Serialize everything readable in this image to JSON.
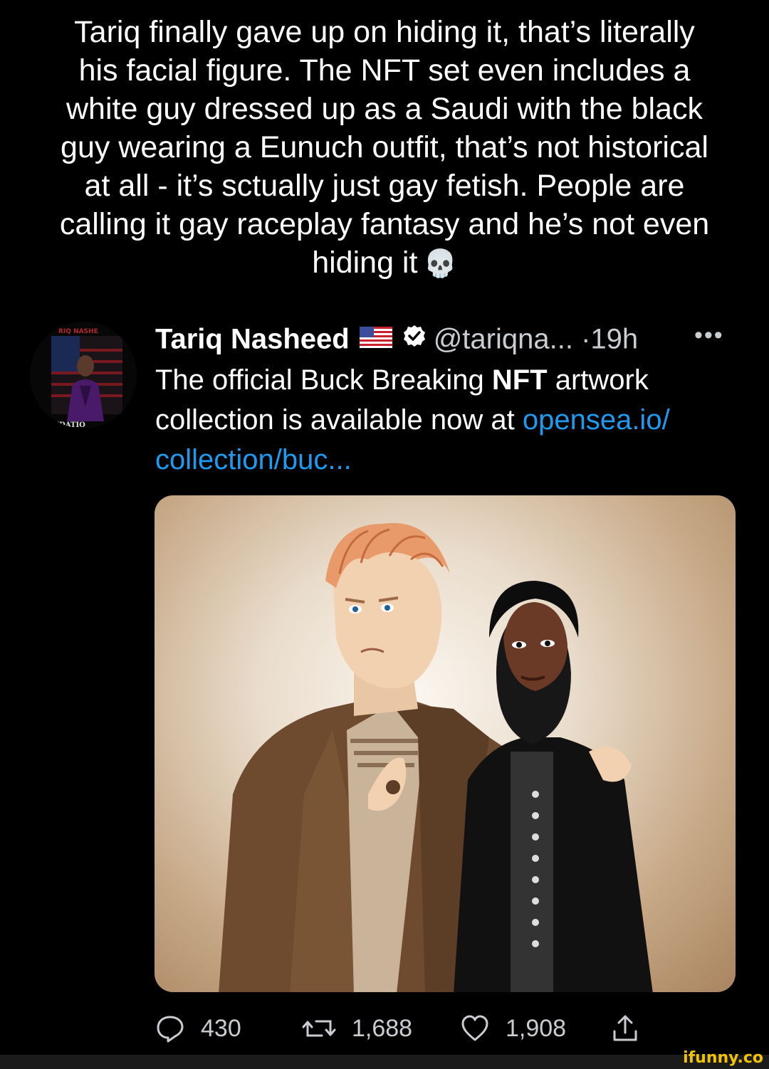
{
  "caption": {
    "lines": [
      "Tariq finally gave up on hiding it, that’s literally",
      "his facial figure. The NFT set even includes a",
      "white guy dressed up as a Saudi with the black",
      "guy wearing a Eunuch outfit, that’s not historical",
      "at all - it’s sctually just gay fetish. People are",
      "calling it gay raceplay fantasy and he’s not even",
      "hiding it"
    ],
    "emoji": "💀"
  },
  "tweet": {
    "author_name": "Tariq Nasheed",
    "handle": "@tariqna...",
    "separator": "·",
    "time": "19h",
    "more": "•••",
    "text_prefix": "The official Buck Breaking ",
    "text_bold": "NFT",
    "text_middle": " artwork collection is available now at ",
    "link": "opensea.io/ collection/buc...",
    "avatar_text_top": "RIQ NASHE",
    "avatar_text_bottom": "NDATIO"
  },
  "actions": {
    "replies": "430",
    "retweets": "1,688",
    "likes": "1,908"
  },
  "watermark": "ifunny.co",
  "colors": {
    "background": "#000000",
    "link": "#1d9bf0",
    "muted": "#c9cdd2",
    "verified": "#ffffff"
  }
}
